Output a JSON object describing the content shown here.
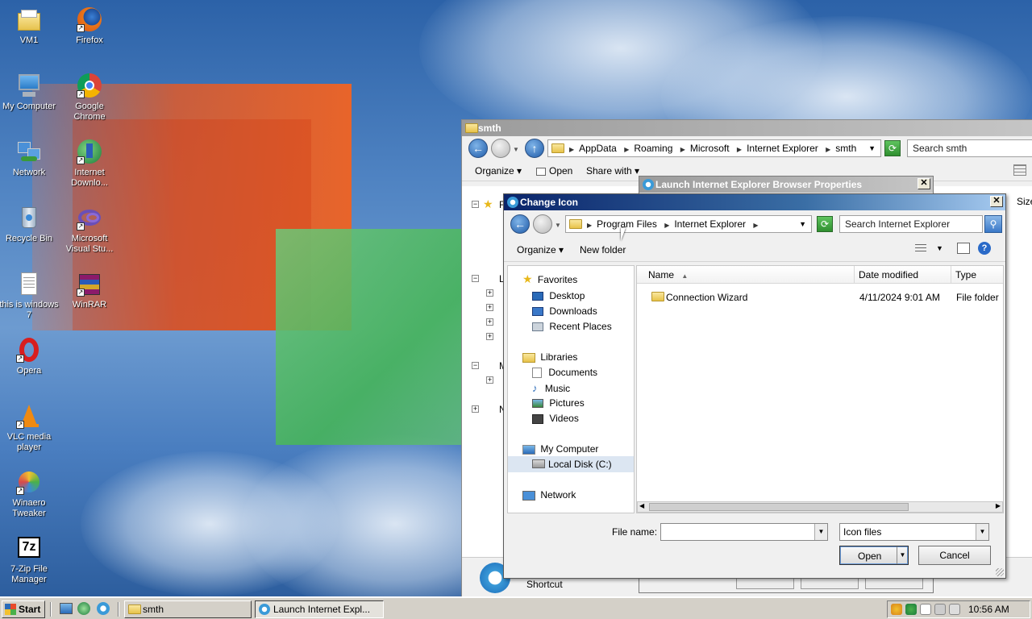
{
  "desktop": {
    "icons": [
      {
        "label": "VM1",
        "icon": "folder-icon"
      },
      {
        "label": "Firefox",
        "icon": "firefox-icon"
      },
      {
        "label": "My Computer",
        "icon": "computer-icon"
      },
      {
        "label": "Google Chrome",
        "icon": "chrome-icon"
      },
      {
        "label": "Network",
        "icon": "network-icon"
      },
      {
        "label": "Internet Downlo...",
        "icon": "idm-icon"
      },
      {
        "label": "Recycle Bin",
        "icon": "recycle-bin-icon"
      },
      {
        "label": "Microsoft Visual Stu...",
        "icon": "visual-studio-icon"
      },
      {
        "label": "this is windows 7",
        "icon": "text-file-icon"
      },
      {
        "label": "WinRAR",
        "icon": "winrar-icon"
      },
      {
        "label": "Opera",
        "icon": "opera-icon"
      },
      {
        "label": "VLC media player",
        "icon": "vlc-icon"
      },
      {
        "label": "Winaero Tweaker",
        "icon": "winaero-icon"
      },
      {
        "label": "7-Zip File Manager",
        "icon": "7zip-icon"
      }
    ]
  },
  "explorer": {
    "title": "smth",
    "breadcrumbs": [
      "AppData",
      "Roaming",
      "Microsoft",
      "Internet Explorer",
      "smth"
    ],
    "search_placeholder": "Search smth",
    "cmd": {
      "organize": "Organize",
      "open": "Open",
      "share_with": "Share with"
    },
    "col_size": "Size",
    "tree_letters": [
      "F",
      "L",
      "M",
      "N"
    ],
    "shortcut_label": "Shortcut"
  },
  "props_dialog": {
    "title": "Launch Internet Explorer Browser Properties"
  },
  "change_icon": {
    "title": "Change Icon",
    "breadcrumbs": [
      "Program Files",
      "Internet Explorer"
    ],
    "search_placeholder": "Search Internet Explorer",
    "cmd": {
      "organize": "Organize",
      "new_folder": "New folder"
    },
    "nav": {
      "favorites": "Favorites",
      "desktop": "Desktop",
      "downloads": "Downloads",
      "recent_places": "Recent Places",
      "libraries": "Libraries",
      "documents": "Documents",
      "music": "Music",
      "pictures": "Pictures",
      "videos": "Videos",
      "my_computer": "My Computer",
      "local_disk": "Local Disk (C:)",
      "network": "Network"
    },
    "columns": {
      "name": "Name",
      "date_modified": "Date modified",
      "type": "Type"
    },
    "rows": [
      {
        "name": "Connection Wizard",
        "date": "4/11/2024 9:01 AM",
        "type": "File folder"
      }
    ],
    "file_name_label": "File name:",
    "file_name_value": "",
    "filter": "Icon files",
    "open_btn": "Open",
    "cancel_btn": "Cancel"
  },
  "taskbar": {
    "start": "Start",
    "tasks": [
      "smth",
      "Launch Internet Expl..."
    ],
    "clock": "10:56 AM"
  }
}
